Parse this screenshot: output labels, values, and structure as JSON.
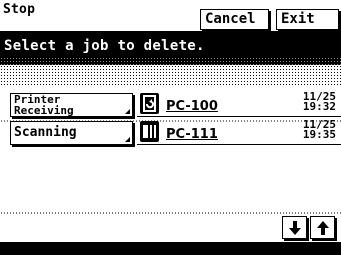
{
  "header": {
    "title": "Stop",
    "cancel_label": "Cancel",
    "exit_label": "Exit"
  },
  "message": "Select a job to delete.",
  "jobs": [
    {
      "type_line1": "Printer",
      "type_line2": "Receiving",
      "icon": "printer-receive-icon",
      "name": "PC-100",
      "date": "11/25",
      "time": "19:32"
    },
    {
      "type": "Scanning",
      "icon": "scanner-icon",
      "name": "PC-111",
      "date": "11/25",
      "time": "19:35"
    }
  ],
  "scroll": {
    "down_icon": "arrow-down-icon",
    "up_icon": "arrow-up-icon"
  }
}
